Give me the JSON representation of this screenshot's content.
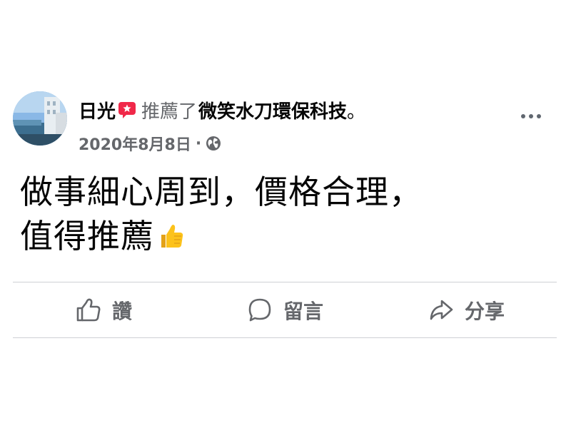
{
  "post": {
    "author": "日光",
    "recommend_verb": "推薦了",
    "page_name": "微笑水刀環保科技",
    "period": "。",
    "date": "2020年8月8日",
    "meta_separator": "·",
    "visibility_icon": "globe-icon",
    "more_icon": "more-options-icon",
    "body_line_1": "做事細心周到，價格合理，",
    "body_line_2": "值得推薦",
    "body_emoji": "thumbs-up-emoji"
  },
  "actions": {
    "like_label": "讚",
    "comment_label": "留言",
    "share_label": "分享"
  },
  "colors": {
    "recommend_badge": "#f02849",
    "secondary_text": "#65676b",
    "divider": "#ced0d4",
    "emoji": "#fcc21b"
  }
}
